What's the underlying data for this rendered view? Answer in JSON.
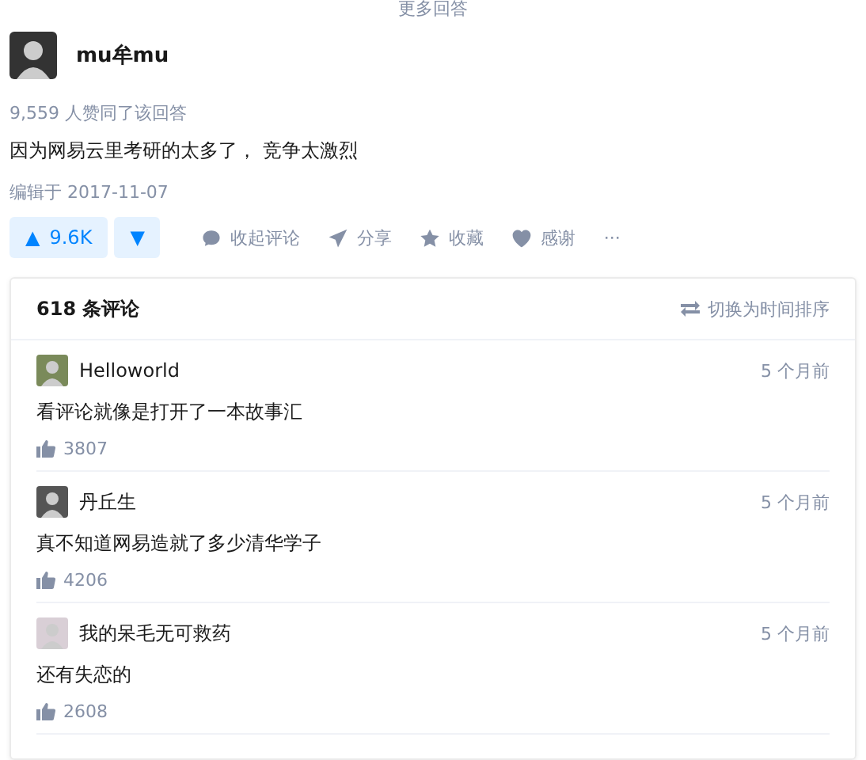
{
  "more_answers": "更多回答",
  "answer": {
    "author": "mu牟mu",
    "approvals": "9,559 人赞同了该回答",
    "content": "因为网易云里考研的太多了， 竞争太激烈",
    "edited": "编辑于 2017-11-07"
  },
  "actions": {
    "upvote": {
      "arrow": "▲",
      "count": "9.6K"
    },
    "downvote": "▼",
    "items": [
      {
        "kind": "comment",
        "label": "收起评论"
      },
      {
        "kind": "share",
        "label": "分享"
      },
      {
        "kind": "star",
        "label": "收藏"
      },
      {
        "kind": "heart",
        "label": "感谢"
      }
    ],
    "more": "···"
  },
  "comments": {
    "count": "618 条评论",
    "sort": "切换为时间排序",
    "items": [
      {
        "author": "Helloworld",
        "time": "5 个月前",
        "text": "看评论就像是打开了一本故事汇",
        "likes": "3807"
      },
      {
        "author": "丹丘生",
        "time": "5 个月前",
        "text": "真不知道网易造就了多少清华学子",
        "likes": "4206"
      },
      {
        "author": "我的呆毛无可救药",
        "time": "5 个月前",
        "text": "还有失恋的",
        "likes": "2608"
      }
    ]
  }
}
